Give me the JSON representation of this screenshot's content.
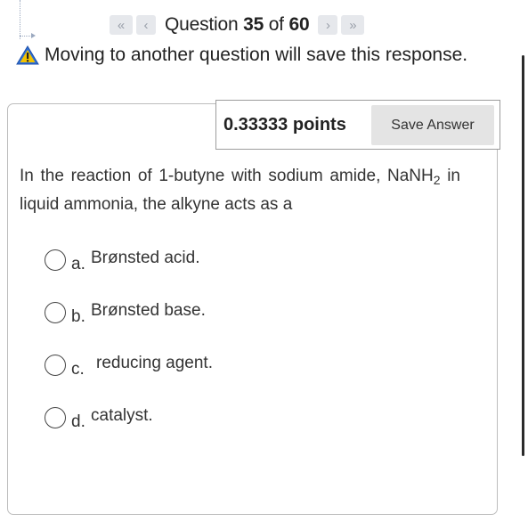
{
  "navigation": {
    "question_label": "Question",
    "question_number": "35",
    "of_label": "of",
    "total": "60",
    "first_glyph": "«",
    "prev_glyph": "‹",
    "next_glyph": "›",
    "last_glyph": "»"
  },
  "notice": {
    "text": "Moving to another question will save this response."
  },
  "score": {
    "points": "0.33333 points",
    "save_label": "Save Answer"
  },
  "question": {
    "text_before": "In the reaction of 1-butyne with sodium amide, NaNH",
    "subscript": "2",
    "text_after": " in liquid ammonia, the alkyne acts as a"
  },
  "options": [
    {
      "letter": "a.",
      "text": "Brønsted acid."
    },
    {
      "letter": "b.",
      "text": "Brønsted base."
    },
    {
      "letter": "c.",
      "text": "reducing agent."
    },
    {
      "letter": "d.",
      "text": "catalyst."
    }
  ],
  "colors": {
    "warning_fill": "#2f6fd6",
    "warning_mark": "#f2c200"
  }
}
